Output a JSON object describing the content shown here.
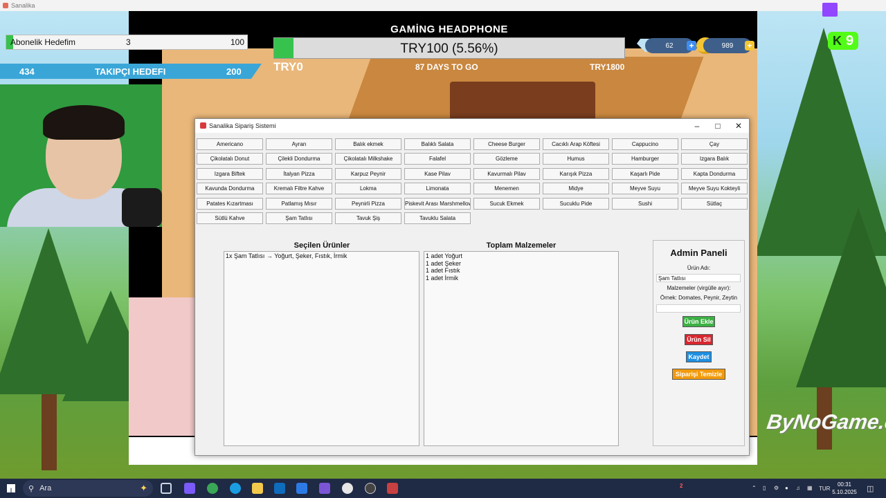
{
  "os": {
    "window_title": "Sanalika"
  },
  "stream": {
    "sub_goal": {
      "label": "Abonelik Hedefim",
      "current": "3",
      "max": "100",
      "progress": 0.03
    },
    "follow_goal": {
      "current": "434",
      "label": "TAKIPÇI HEDEFI",
      "max": "200"
    },
    "kick": {
      "count": "9"
    },
    "watermark": "ByNoGame.com"
  },
  "game_hud": {
    "title": "GAMİNG HEADPHONE",
    "progress_text": "TRY100 (5.56%)",
    "progress": 0.0556,
    "min_label": "TRY0",
    "days_label": "87 DAYS TO GO",
    "max_label": "TRY1800",
    "gems": "62",
    "coins": "989"
  },
  "app": {
    "title": "Sanalika Sipariş Sistemi",
    "products": [
      "Americano",
      "Ayran",
      "Balık ekmek",
      "Balıklı Salata",
      "Cheese Burger",
      "Cacıklı Arap Köftesi",
      "Cappucino",
      "Çay",
      "Çikolatalı Donut",
      "Çilekli Dondurma",
      "Çikolatalı Milkshake",
      "Falafel",
      "Gözleme",
      "Humus",
      "Hamburger",
      "Izgara Balık",
      "Izgara Biftek",
      "İtalyan Pizza",
      "Karpuz Peynir",
      "Kase Pilav",
      "Kavurmalı Pilav",
      "Karışık Pizza",
      "Kaşarlı Pide",
      "Kapta Dondurma",
      "Kavunda Dondurma",
      "Kremalı Filtre Kahve",
      "Lokma",
      "Limonata",
      "Menemen",
      "Midye",
      "Meyve Suyu",
      "Meyve Suyu Kokteyli",
      "Patates Kızartması",
      "Patlamış Mısır",
      "Peynirli Pizza",
      "Piskevit Arası Marshmellow",
      "Sucuk Ekmek",
      "Sucuklu Pide",
      "Sushi",
      "Sütlaç",
      "Sütlü Kahve",
      "Şam Tatlısı",
      "Tavuk Şiş",
      "Tavuklu Salata"
    ],
    "selected": {
      "heading": "Seçilen Ürünler",
      "items": [
        "1x Şam Tatlısı → Yoğurt, Şeker, Fıstık, İrmik"
      ]
    },
    "ingredients": {
      "heading": "Toplam Malzemeler",
      "items": [
        "1 adet Yoğurt",
        "1 adet Şeker",
        "1 adet Fıstık",
        "1 adet İrmik"
      ]
    },
    "admin": {
      "title": "Admin Paneli",
      "name_label": "Ürün Adı:",
      "name_value": "Şam Tatlısı",
      "ingredients_label": "Malzemeler (virgülle ayır):",
      "example": "Örnek: Domates, Peynir, Zeytin",
      "ingredients_value": "",
      "add_button": "Ürün Ekle",
      "delete_button": "Ürün Sil",
      "save_button": "Kaydet",
      "clear_button": "Siparişi Temizle",
      "colors": {
        "add": "#3cb043",
        "delete": "#d8262f",
        "save": "#1e8fe0",
        "clear": "#f29a0d"
      }
    }
  },
  "taskbar": {
    "search_placeholder": "Ara",
    "notification_count": "2",
    "language": "TUR",
    "time": "00:31",
    "date": "5.10.2025"
  }
}
